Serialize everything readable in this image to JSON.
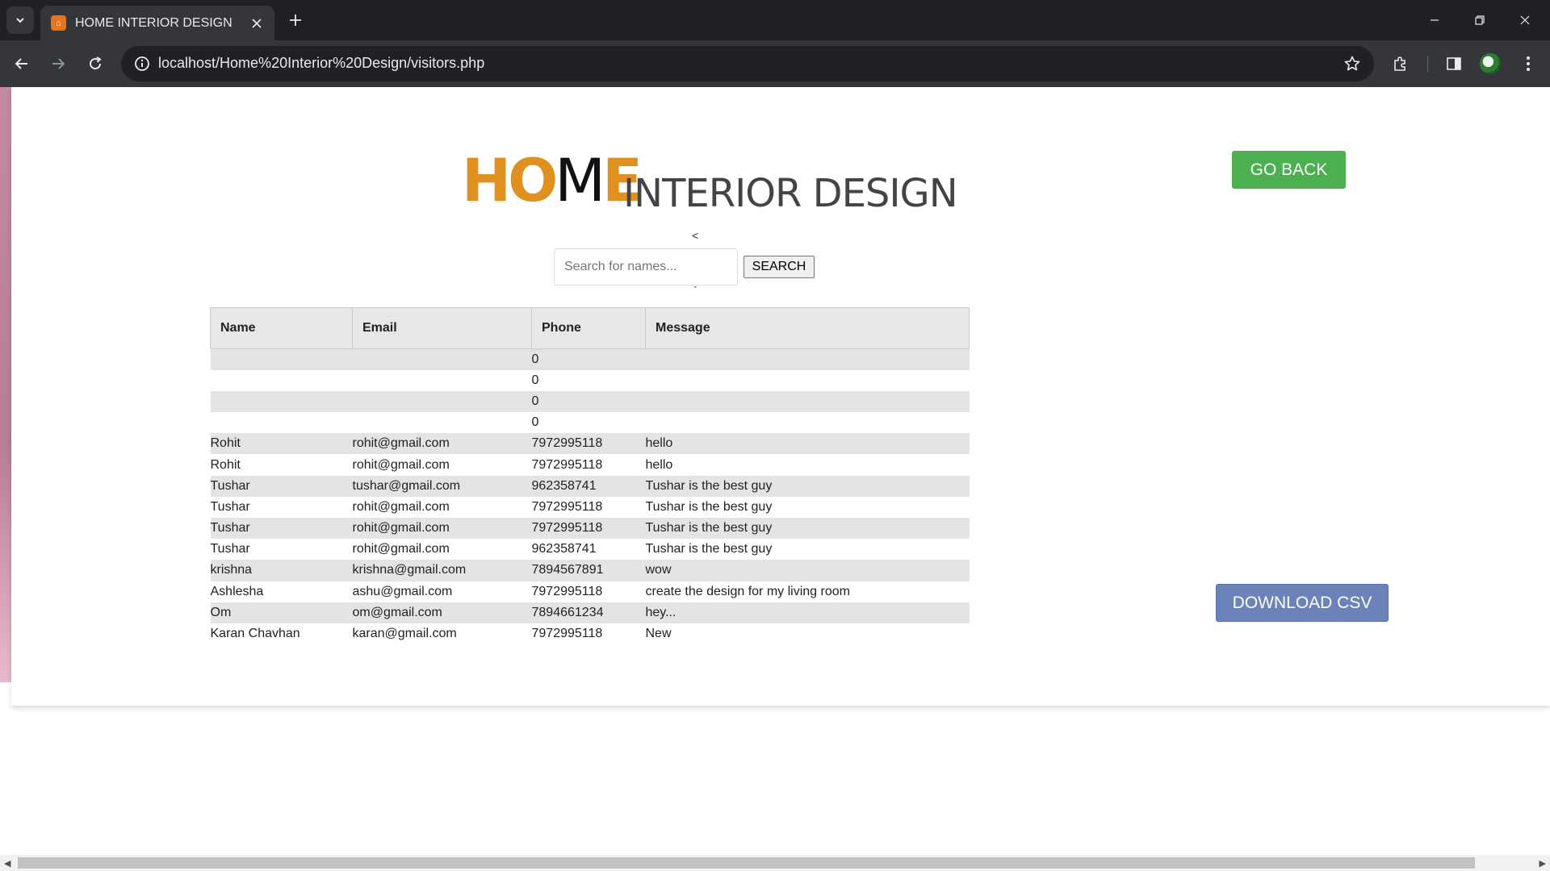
{
  "browser": {
    "tab_title": "HOME INTERIOR DESIGN",
    "favicon_text": "⌂",
    "url": "localhost/Home%20Interior%20Design/visitors.php",
    "icons": [
      "tab-search-icon",
      "close-icon",
      "plus-icon",
      "minimize-icon",
      "restore-icon",
      "close-window-icon",
      "back-arrow-icon",
      "forward-arrow-icon",
      "reload-icon",
      "site-info-icon",
      "star-icon",
      "extensions-icon",
      "side-panel-icon",
      "profile-avatar"
    ]
  },
  "header": {
    "logo_ho": "HO",
    "logo_m": "M",
    "logo_e": "E",
    "logo_rest": "INTERIOR DESIGN",
    "brand_color": "#e0901e"
  },
  "stray_chars": {
    "lt": "<",
    "tick": "`"
  },
  "search": {
    "placeholder": "Search for names...",
    "value": "",
    "button_label": "SEARCH"
  },
  "actions": {
    "go_back": "GO BACK",
    "go_back_color": "#4caf50",
    "download_csv": "DOWNLOAD CSV",
    "download_color": "#6c83b9"
  },
  "table": {
    "headers": [
      "Name",
      "Email",
      "Phone",
      "Message"
    ],
    "rows": [
      [
        "",
        "",
        "0",
        ""
      ],
      [
        "",
        "",
        "0",
        ""
      ],
      [
        "",
        "",
        "0",
        ""
      ],
      [
        "",
        "",
        "0",
        ""
      ],
      [
        "Rohit",
        "rohit@gmail.com",
        "7972995118",
        "hello"
      ],
      [
        "Rohit",
        "rohit@gmail.com",
        "7972995118",
        "hello"
      ],
      [
        "Tushar",
        "tushar@gmail.com",
        "962358741",
        "Tushar is the best guy"
      ],
      [
        "Tushar",
        "rohit@gmail.com",
        "7972995118",
        "Tushar is the best guy"
      ],
      [
        "Tushar",
        "rohit@gmail.com",
        "7972995118",
        "Tushar is the best guy"
      ],
      [
        "Tushar",
        "rohit@gmail.com",
        "962358741",
        "Tushar is the best guy"
      ],
      [
        "krishna",
        "krishna@gmail.com",
        "7894567891",
        "wow"
      ],
      [
        "Ashlesha",
        "ashu@gmail.com",
        "7972995118",
        "create the design for my living room"
      ],
      [
        "Om",
        "om@gmail.com",
        "7894661234",
        "hey..."
      ],
      [
        "Karan Chavhan",
        "karan@gmail.com",
        "7972995118",
        "New"
      ]
    ]
  }
}
